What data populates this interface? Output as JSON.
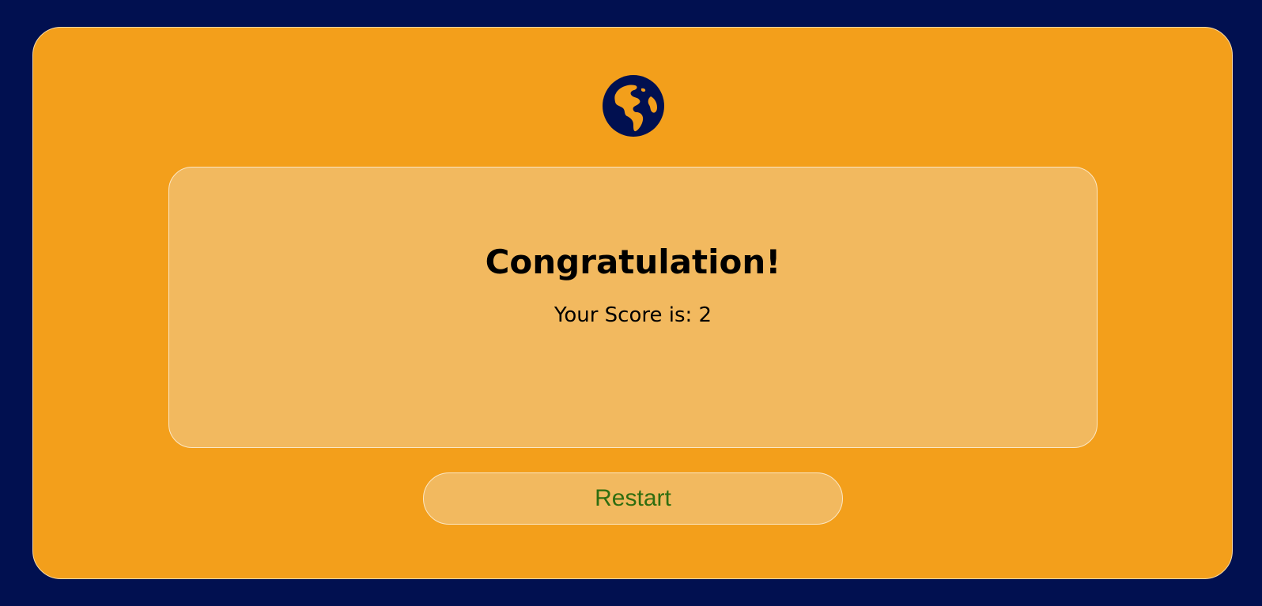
{
  "colors": {
    "background": "#011050",
    "card": "#f39f1b",
    "panel": "#f2b95f",
    "restart_text": "#2f6d10"
  },
  "header": {
    "icon": "globe-icon"
  },
  "result": {
    "title": "Congratulation!",
    "score_text": "Your Score is: 2"
  },
  "actions": {
    "restart_label": "Restart"
  }
}
